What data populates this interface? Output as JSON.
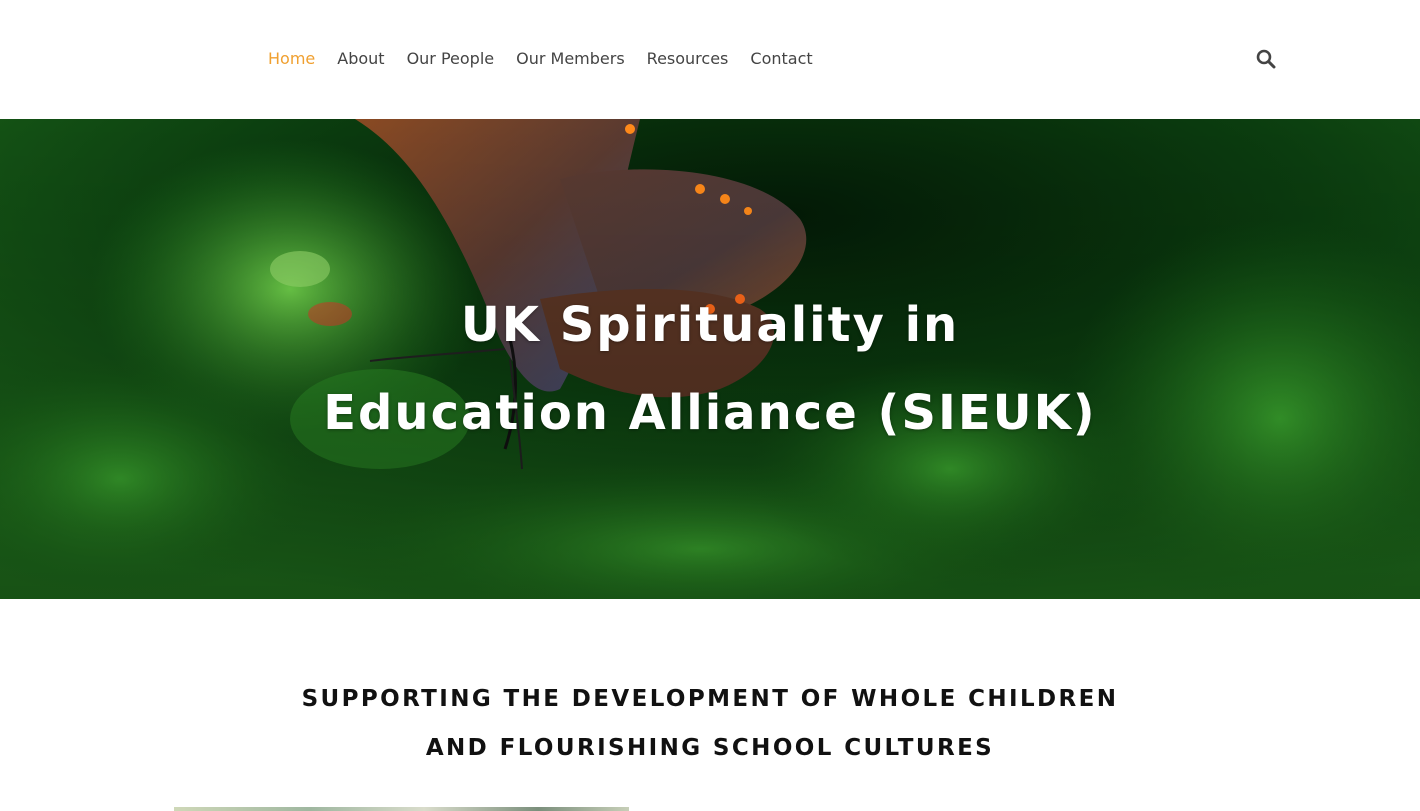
{
  "nav": {
    "items": [
      {
        "label": "Home",
        "active": true
      },
      {
        "label": "About",
        "active": false
      },
      {
        "label": "Our People",
        "active": false
      },
      {
        "label": "Our Members",
        "active": false
      },
      {
        "label": "Resources",
        "active": false
      },
      {
        "label": "Contact",
        "active": false
      }
    ],
    "active_color": "#f0a030",
    "search_icon": "search-icon"
  },
  "hero": {
    "title_line1": "UK Spirituality in",
    "title_line2": "Education Alliance (SIEUK)",
    "image": "butterfly-on-green-foliage"
  },
  "section": {
    "heading_line1": "SUPPORTING THE DEVELOPMENT OF WHOLE CHILDREN",
    "heading_line2": "AND FLOURISHING SCHOOL CULTURES"
  }
}
